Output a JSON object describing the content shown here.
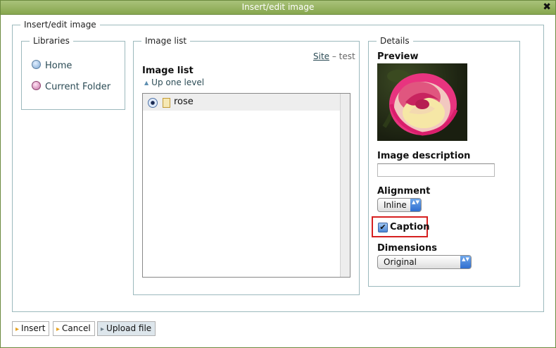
{
  "window": {
    "title": "Insert/edit image",
    "close_glyph": "✖"
  },
  "main": {
    "legend": "Insert/edit image"
  },
  "libraries": {
    "legend": "Libraries",
    "items": [
      {
        "label": "Home",
        "icon": "home-globe-icon"
      },
      {
        "label": "Current Folder",
        "icon": "folder-globe-icon"
      }
    ]
  },
  "image_list": {
    "legend": "Image list",
    "breadcrumb_link": "Site",
    "breadcrumb_rest": " – test",
    "heading": "Image list",
    "up_arrow": "▲",
    "up_label": "Up one level",
    "items": [
      {
        "label": "rose",
        "selected": true,
        "icon": "file-icon"
      }
    ]
  },
  "details": {
    "legend": "Details",
    "preview_label": "Preview",
    "preview_image": "rose-photo",
    "description_label": "Image description",
    "description_value": "",
    "alignment_label": "Alignment",
    "alignment_value": "Inline",
    "caption_label": "Caption",
    "caption_checked": true,
    "check_glyph": "✔",
    "dimensions_label": "Dimensions",
    "dimensions_value": "Original",
    "select_arrows": "▲▼"
  },
  "footer": {
    "insert_label": "Insert",
    "cancel_label": "Cancel",
    "upload_label": "Upload file"
  },
  "colors": {
    "titlebar": "#87a74e",
    "fieldset_border": "#9cb9bd",
    "highlight": "#d62020"
  }
}
